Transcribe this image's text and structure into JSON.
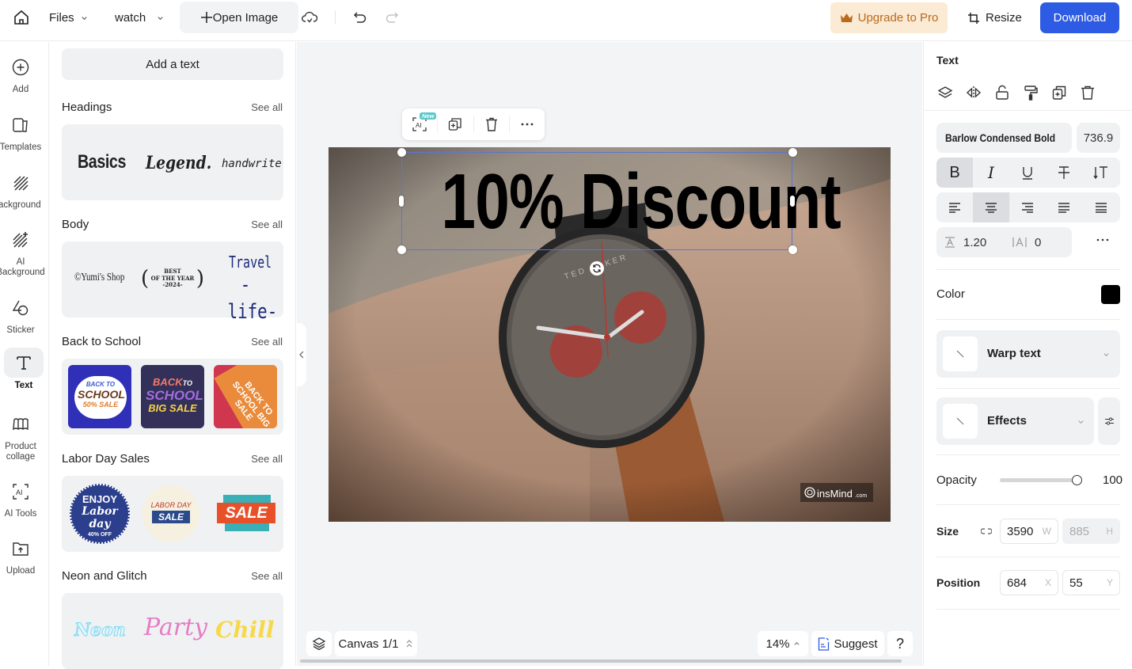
{
  "topbar": {
    "files_label": "Files",
    "project_name": "watch",
    "open_image_label": "Open Image",
    "upgrade_label": "Upgrade to Pro",
    "resize_label": "Resize",
    "download_label": "Download",
    "colors": {
      "accent": "#2d5be3",
      "upgrade_bg": "#fbead4",
      "upgrade_fg": "#b96a1c"
    }
  },
  "rail": {
    "items": [
      {
        "label": "Add",
        "icon": "plus-circle-icon"
      },
      {
        "label": "Templates",
        "icon": "templates-icon"
      },
      {
        "label": "Background",
        "icon": "background-icon"
      },
      {
        "label": "AI Background",
        "icon": "ai-background-icon"
      },
      {
        "label": "Sticker",
        "icon": "sticker-icon"
      },
      {
        "label": "Text",
        "icon": "text-icon",
        "active": true
      },
      {
        "label": "Product collage",
        "icon": "collage-icon"
      },
      {
        "label": "AI Tools",
        "icon": "ai-tools-icon"
      },
      {
        "label": "Upload",
        "icon": "upload-icon"
      }
    ]
  },
  "panel": {
    "add_text_label": "Add a text",
    "see_all_label": "See all",
    "sections": [
      {
        "title": "Headings",
        "samples": [
          "Basics",
          "Legend.",
          "handwrite"
        ]
      },
      {
        "title": "Body",
        "samples": [
          "©Yumi's Shop",
          "BEST OF THE YEAR -2024-",
          "Travel the -life-"
        ]
      },
      {
        "title": "Back to School",
        "samples": [
          "BACK TO SCHOOL 50% SALE",
          "BACK TO SCHOOL BIG SALE",
          "BACK TO SCHOOL BIG SALE"
        ]
      },
      {
        "title": "Labor Day Sales",
        "samples": [
          "ENJOY Labor day 40% OFF",
          "LABOR DAY SALE",
          "SALE LABOR DAY"
        ]
      },
      {
        "title": "Neon and Glitch",
        "samples": [
          "Neon",
          "Party",
          "Chill"
        ]
      }
    ]
  },
  "canvas": {
    "text": "10% Discount",
    "watermark": "insMind",
    "watermark_suffix": ".com",
    "dial_brand": "TED BAKER",
    "float_toolbar": {
      "new_badge": "New"
    },
    "canvas_label": "Canvas 1/1",
    "zoom": "14%",
    "suggest_label": "Suggest",
    "help_label": "?"
  },
  "props": {
    "title": "Text",
    "font_name": "Barlow Condensed Bold",
    "font_size": "736.9",
    "style_buttons": [
      "B",
      "I",
      "U",
      "S",
      "IT"
    ],
    "style_active": "bold",
    "align_active": "center",
    "line_height": "1.20",
    "letter_spacing": "0",
    "color_label": "Color",
    "color_value": "#000000",
    "warp_label": "Warp text",
    "effects_label": "Effects",
    "opacity_label": "Opacity",
    "opacity_value": "100",
    "opacity_fraction": 1.0,
    "size_label": "Size",
    "width": "3590",
    "width_suffix": "W",
    "height": "885",
    "height_suffix": "H",
    "position_label": "Position",
    "x": "684",
    "x_suffix": "X",
    "y": "55",
    "y_suffix": "Y"
  }
}
